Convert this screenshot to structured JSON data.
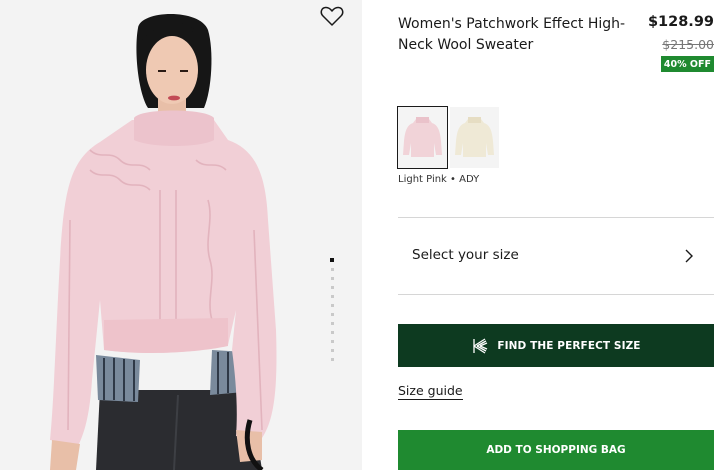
{
  "product": {
    "title": "Women's Patchwork Effect High-Neck Wool Sweater",
    "price": "$128.99",
    "old_price": "$215.00",
    "discount_badge": "40% OFF"
  },
  "gallery": {
    "favorite_icon": "heart-outline-icon",
    "total_images": 8,
    "active_image": 1
  },
  "swatches": [
    {
      "name": "Light Pink",
      "selected": true,
      "color": "#f1d3d8"
    },
    {
      "name": "Ecru",
      "selected": false,
      "color": "#efe9d6"
    }
  ],
  "color_label": "Light Pink • ADY",
  "size_selector": {
    "label": "Select your size",
    "icon": "chevron-right-icon"
  },
  "buttons": {
    "find_size": "FIND THE PERFECT SIZE",
    "size_guide": "Size guide",
    "add_to_bag": "ADD TO SHOPPING BAG"
  },
  "colors": {
    "dark_green": "#0d3a20",
    "brand_green": "#1f8a30"
  }
}
